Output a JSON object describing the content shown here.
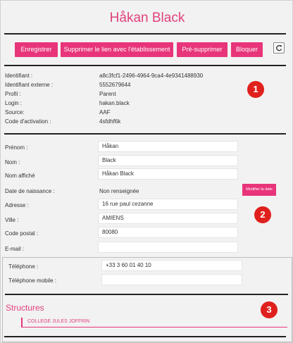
{
  "header": {
    "title": "Håkan Black"
  },
  "toolbar": {
    "save_label": "Enregistrer",
    "remove_link_label": "Supprimer le lien avec l'établissement",
    "pre_delete_label": "Pré-supprimer",
    "block_label": "Bloquer",
    "refresh_icon": "refresh-icon"
  },
  "info": {
    "rows": [
      {
        "label": "Identifiant :",
        "value": "a8c3fcf1-2496-4964-9ca4-4e9341488930"
      },
      {
        "label": "Identifiant externe :",
        "value": "5552679644"
      },
      {
        "label": "Profil :",
        "value": "Parent"
      },
      {
        "label": "Login :",
        "value": "hakan.black"
      },
      {
        "label": "Source:",
        "value": "AAF"
      },
      {
        "label": "Code d'activation :",
        "value": "4sfdhf6k"
      }
    ]
  },
  "form": {
    "firstname_label": "Prénom :",
    "firstname_value": "Håkan",
    "lastname_label": "Nom :",
    "lastname_value": "Black",
    "display_label": "Nom affiché",
    "display_value": "Håkan Black",
    "birth_label": "Date de naissance :",
    "birth_value": "Non renseignée",
    "modify_date_label": "Modifier la date",
    "address_label": "Adresse :",
    "address_value": "16 rue paul cezanne",
    "city_label": "Ville :",
    "city_value": "AMIENS",
    "zip_label": "Code postal :",
    "zip_value": "80080",
    "email_label": "E-mail :",
    "email_value": ""
  },
  "phones": {
    "phone_label": "Téléphone :",
    "phone_value": "+33 3 60 01 40 10",
    "mobile_label": "Téléphone mobile :",
    "mobile_value": ""
  },
  "structures": {
    "title": "Structures",
    "items": [
      "COLLEGE JULES JOFFRIN"
    ]
  },
  "annotations": {
    "badge_1": "1",
    "badge_2": "2",
    "badge_3": "3"
  },
  "colors": {
    "accent": "#e8357a",
    "title": "#e0417d",
    "badge": "#e0201c"
  }
}
